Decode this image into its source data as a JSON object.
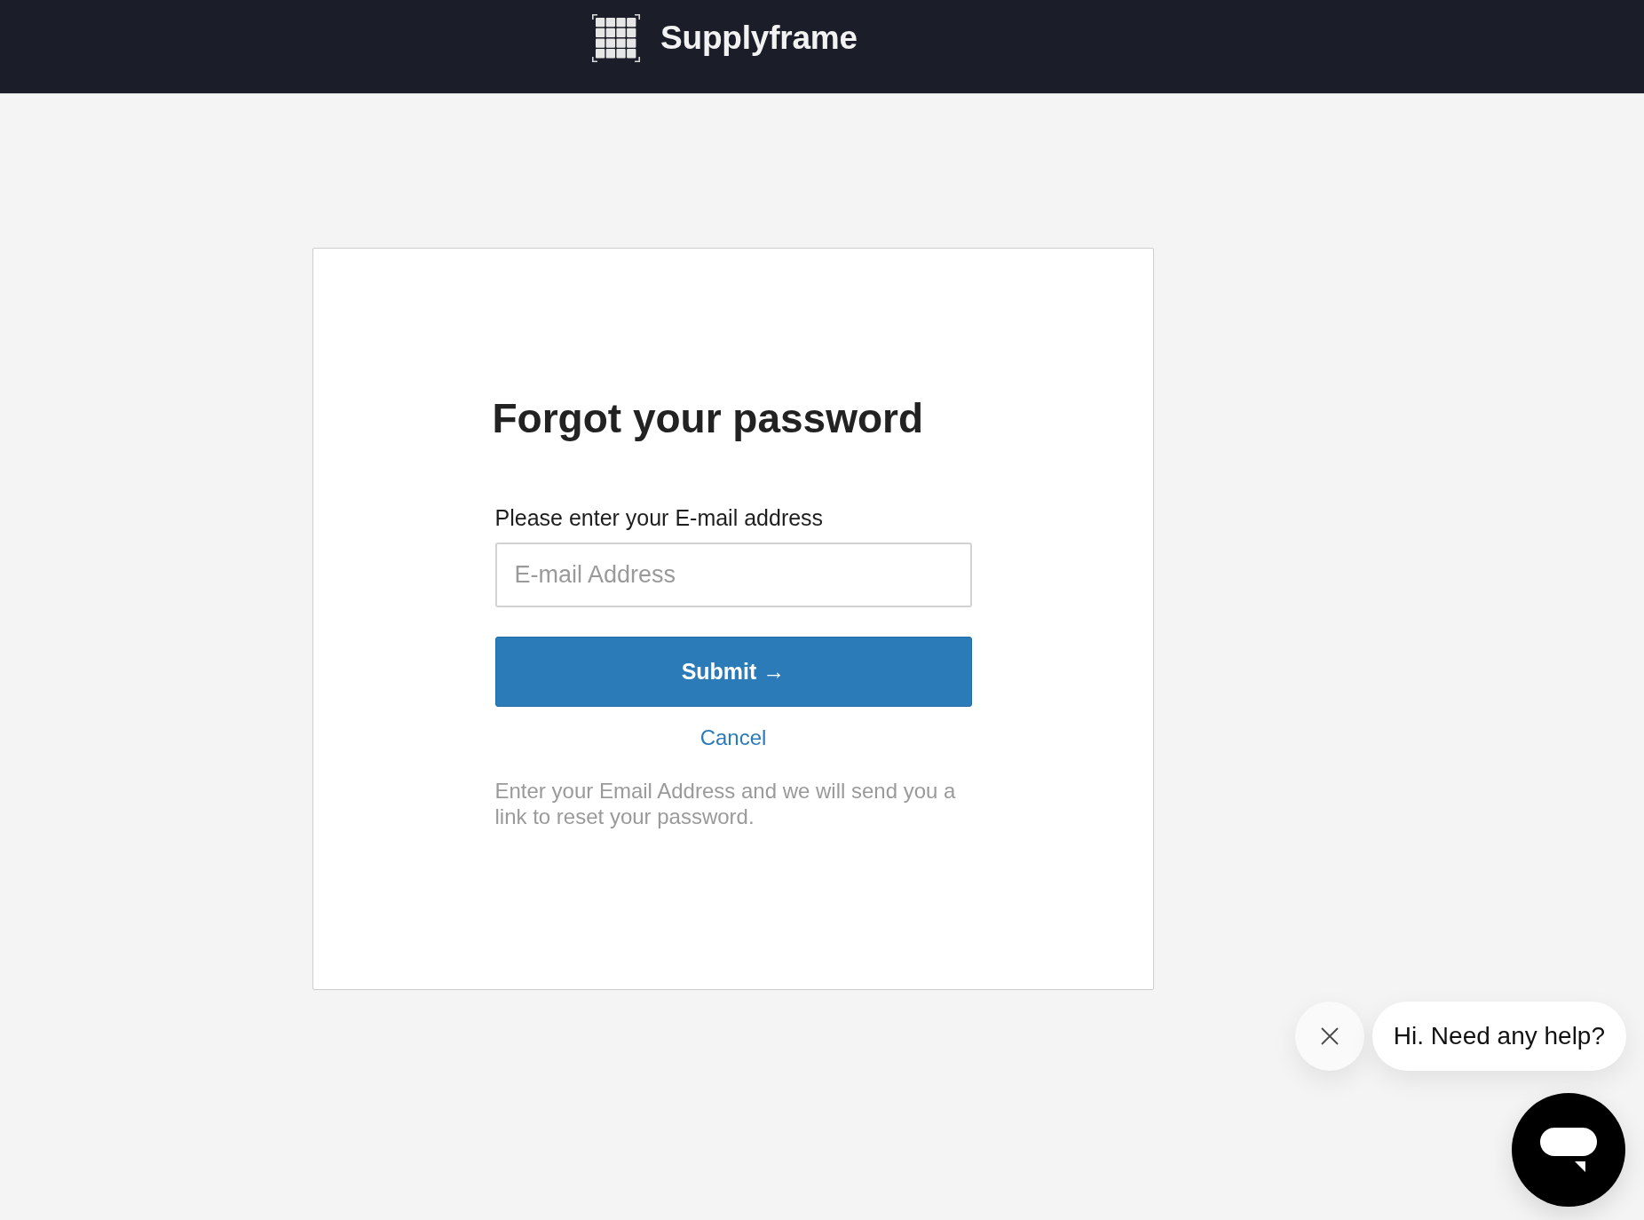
{
  "header": {
    "brand": "Supplyframe"
  },
  "form": {
    "title": "Forgot your password",
    "email_label": "Please enter your E-mail address",
    "email_field": {
      "placeholder": "E-mail Address"
    },
    "submit_button": "Submit →",
    "cancel_link": "Cancel",
    "help_text": "Enter your Email Address and we will send you a link to reset your password."
  },
  "chat_widget": {
    "greeting": "Hi. Need any help?"
  }
}
